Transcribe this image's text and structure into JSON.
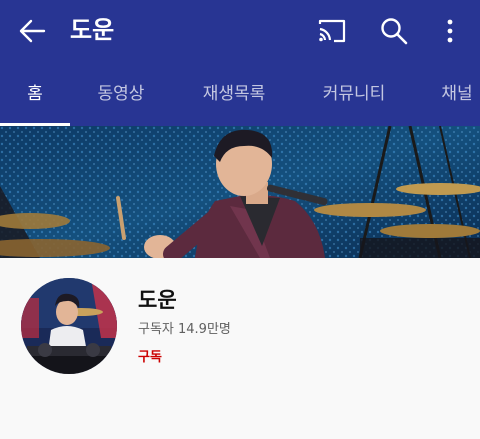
{
  "header": {
    "title": "도운",
    "colors": {
      "appbar": "#283593",
      "text": "#ffffff"
    },
    "icons": [
      "back-arrow-icon",
      "cast-icon",
      "search-icon",
      "more-vert-icon"
    ]
  },
  "tabs": [
    {
      "label": "홈",
      "active": true
    },
    {
      "label": "동영상",
      "active": false
    },
    {
      "label": "재생목록",
      "active": false
    },
    {
      "label": "커뮤니티",
      "active": false
    },
    {
      "label": "채널",
      "active": false
    }
  ],
  "channel": {
    "name": "도운",
    "subscribers": "구독자 14.9만명",
    "subscribe_label": "구독",
    "subscribe_color": "#cc0000"
  }
}
